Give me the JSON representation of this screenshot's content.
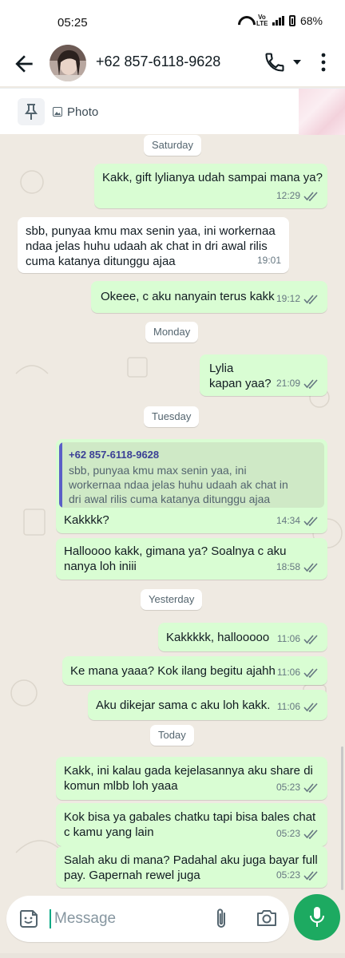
{
  "status_bar": {
    "time": "05:25",
    "network": "Vo LTE",
    "battery": "68%"
  },
  "header": {
    "contact_name": "+62 857-6118-9628"
  },
  "pinned": {
    "label": "Photo"
  },
  "day_labels": {
    "saturday": "Saturday",
    "monday": "Monday",
    "tuesday": "Tuesday",
    "yesterday": "Yesterday",
    "today": "Today"
  },
  "messages": [
    {
      "text": "Kakk, gift lylianya udah sampai mana ya?",
      "time": "12:29"
    },
    {
      "text": "sbb, punyaa kmu max senin yaa, ini workernaa\nndaa jelas huhu udaah ak chat in dri awal rilis\ncuma katanya ditunggu ajaa",
      "time": "19:01"
    },
    {
      "text": "Okeee, c aku nanyain terus kakk",
      "time": "19:12"
    },
    {
      "text": "Lylia\nkapan yaa?",
      "time": "21:09"
    },
    {
      "text": "Kakkkk?",
      "time": "14:34",
      "quote_author": "+62 857-6118-9628",
      "quote_text": "sbb, punyaa kmu max senin yaa, ini\nworkernaa ndaa jelas huhu udaah ak chat in\ndri awal rilis cuma katanya ditunggu ajaa"
    },
    {
      "text": "Halloooo kakk, gimana ya? Soalnya c aku\nnanya loh iniii",
      "time": "18:58"
    },
    {
      "text": "Kakkkkk, hallooooo",
      "time": "11:06"
    },
    {
      "text": "Ke mana yaaa? Kok ilang begitu ajahh",
      "time": "11:06"
    },
    {
      "text": "Aku dikejar sama c aku loh kakk.",
      "time": "11:06"
    },
    {
      "text": "Kakk, ini kalau gada kejelasannya aku share di\nkomun mlbb loh yaaa",
      "time": "05:23"
    },
    {
      "text": "Kok bisa ya gabales chatku tapi bisa bales chat\nc kamu yang lain",
      "time": "05:23"
    },
    {
      "text": "Salah aku di mana? Padahal aku juga bayar full\npay. Gapernah rewel juga",
      "time": "05:23"
    }
  ],
  "composer": {
    "placeholder": "Message"
  },
  "colors": {
    "outgoing_bubble": "#d9fdd3",
    "incoming_bubble": "#ffffff",
    "chat_background": "#efeae2",
    "accent": "#1daa61",
    "read_ticks": "#667781"
  },
  "icons": [
    "back-arrow-icon",
    "voice-call-icon",
    "chevron-down-icon",
    "more-vert-icon",
    "pin-icon",
    "photo-icon",
    "double-tick-icon",
    "sticker-icon",
    "attach-icon",
    "camera-icon",
    "mic-icon"
  ]
}
